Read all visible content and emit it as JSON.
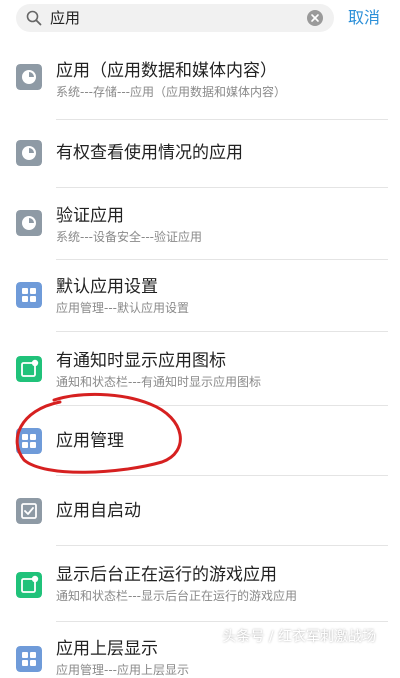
{
  "search": {
    "query": "应用",
    "cancel_label": "取消"
  },
  "results": [
    {
      "title": "应用（应用数据和媒体内容）",
      "subtitle": "系统---存储---应用（应用数据和媒体内容）",
      "icon": "disk-icon"
    },
    {
      "title": "有权查看使用情况的应用",
      "subtitle": "",
      "icon": "disk-icon"
    },
    {
      "title": "验证应用",
      "subtitle": "系统---设备安全---验证应用",
      "icon": "disk-icon"
    },
    {
      "title": "默认应用设置",
      "subtitle": "应用管理---默认应用设置",
      "icon": "apps-grid-icon"
    },
    {
      "title": "有通知时显示应用图标",
      "subtitle": "通知和状态栏---有通知时显示应用图标",
      "icon": "notification-icon"
    },
    {
      "title": "应用管理",
      "subtitle": "",
      "icon": "apps-grid-icon"
    },
    {
      "title": "应用自启动",
      "subtitle": "",
      "icon": "checkbox-icon"
    },
    {
      "title": "显示后台正在运行的游戏应用",
      "subtitle": "通知和状态栏---显示后台正在运行的游戏应用",
      "icon": "notification-icon"
    },
    {
      "title": "应用上层显示",
      "subtitle": "应用管理---应用上层显示",
      "icon": "apps-grid-icon"
    }
  ],
  "watermark": "头条号 / 红衣军刺激战场",
  "colors": {
    "accent": "#2b8fd8",
    "icon_gray": "#8e9aa5",
    "icon_blue": "#6f9bd9",
    "icon_green": "#20c27a",
    "annotation_red": "#d62020"
  }
}
